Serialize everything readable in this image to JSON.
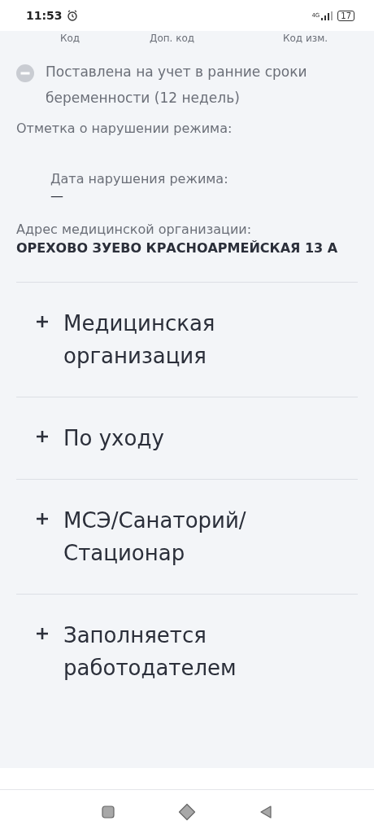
{
  "status_bar": {
    "time": "11:53",
    "network": "4G",
    "battery": "17"
  },
  "code_columns": [
    "Код",
    "Доп. код",
    "Код изм."
  ],
  "status_item": {
    "text": "Поставлена на учет в ранние сроки беременности (12 недель)",
    "checked": false
  },
  "violation": {
    "label": "Отметка о нарушении режима:",
    "date_label": "Дата нарушения режима:",
    "date_value": "—"
  },
  "address": {
    "label": "Адрес медицинской организации:",
    "value": "ОРЕХОВО ЗУЕВО КРАСНОАРМЕЙСКАЯ 13 А"
  },
  "sections": [
    {
      "title": "Медицинская организация",
      "expanded": false
    },
    {
      "title": "По уходу",
      "expanded": false
    },
    {
      "title": "МСЭ/Санаторий/ Стационар",
      "expanded": false
    },
    {
      "title": "Заполняется работодателем",
      "expanded": false
    }
  ]
}
